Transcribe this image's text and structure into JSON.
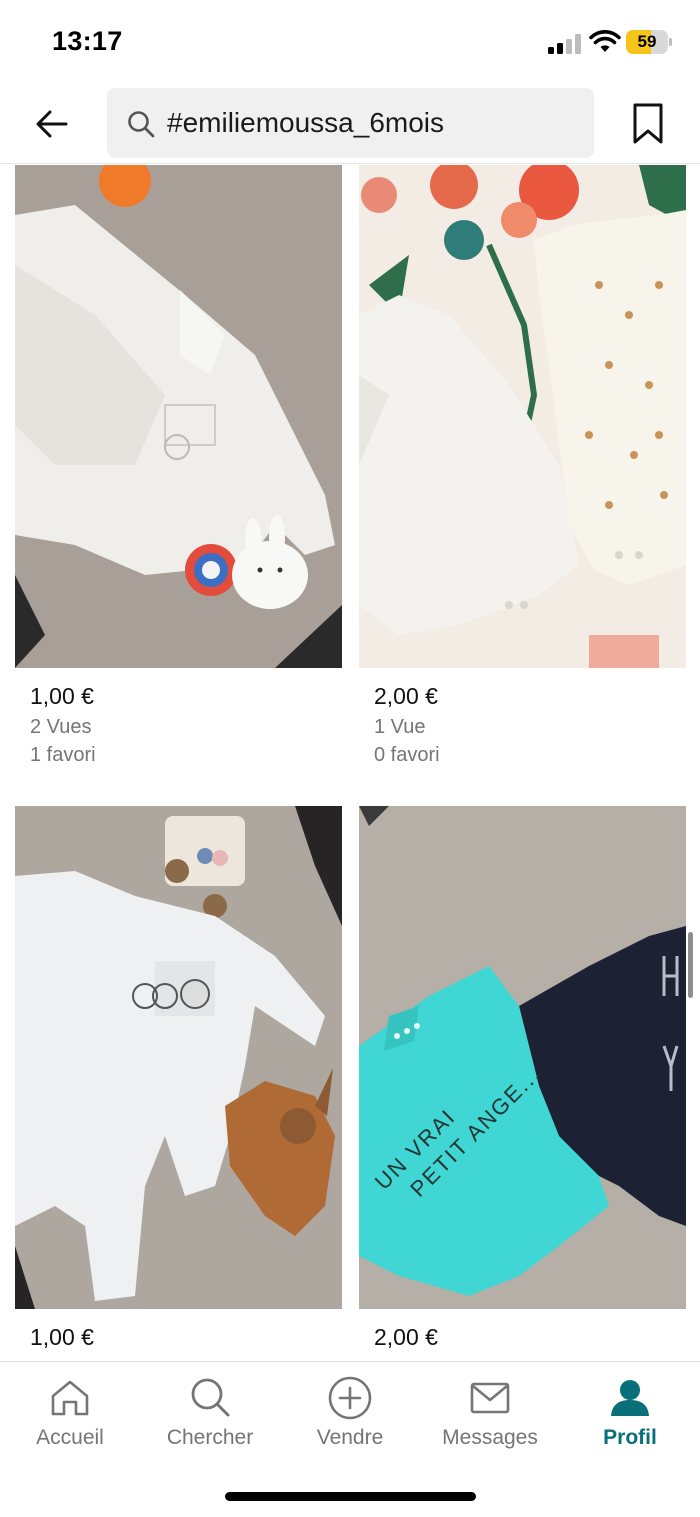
{
  "status_bar": {
    "time": "13:17",
    "battery_level": "59",
    "battery_fraction": 0.59,
    "battery_color": "#f5c518"
  },
  "header": {
    "back_icon": "arrow-left-icon",
    "search_value": "#emiliemoussa_6mois",
    "search_icon": "search-icon",
    "bookmark_icon": "bookmark-icon"
  },
  "items": [
    {
      "price": "1,00 €",
      "views": "2 Vues",
      "favorites": "1 favori",
      "photo": "white baby shirt with plush toys on grey rug"
    },
    {
      "price": "2,00 €",
      "views": "1 Vue",
      "favorites": "0 favori",
      "photo": "two white baby bodysuits on floral fabric"
    },
    {
      "price": "1,00 €",
      "photo": "light blue baby sleepsuit with wooden toy and brown comforter"
    },
    {
      "price": "2,00 €",
      "photo": "turquoise tee and navy long-sleeve top on grey rug"
    }
  ],
  "item_4_print": "UN VRAI PETIT ANGE...",
  "nav": {
    "items": [
      {
        "label": "Accueil",
        "icon": "home-icon",
        "active": false
      },
      {
        "label": "Chercher",
        "icon": "search-icon",
        "active": false
      },
      {
        "label": "Vendre",
        "icon": "plus-circle-icon",
        "active": false
      },
      {
        "label": "Messages",
        "icon": "mail-icon",
        "active": false
      },
      {
        "label": "Profil",
        "icon": "profile-icon",
        "active": true
      }
    ],
    "active_color": "#09707a",
    "inactive_color": "#757575"
  }
}
